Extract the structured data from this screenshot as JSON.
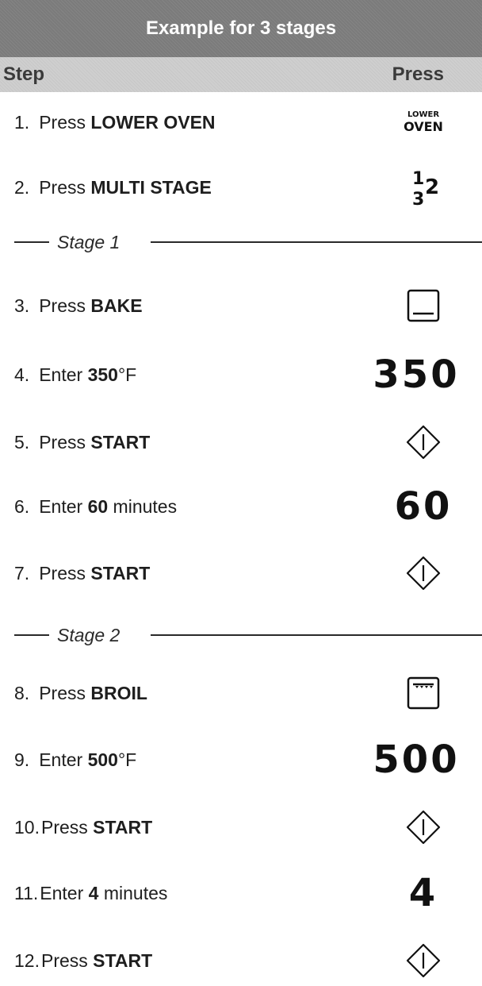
{
  "table": {
    "title": "Example for 3 stages",
    "header_step": "Step",
    "header_press": "Press"
  },
  "rows": [
    {
      "num": "1.",
      "pre": "Press ",
      "bold": "LOWER OVEN",
      "post": "",
      "icon": "lower-oven-icon",
      "icon_top": "LOWER",
      "icon_bottom": "OVEN"
    },
    {
      "num": "2.",
      "pre": "Press ",
      "bold": "MULTI STAGE",
      "post": "",
      "icon": "multi-stage-icon",
      "icon_a": "1",
      "icon_b": "2",
      "icon_c": "3"
    },
    {
      "num": "3.",
      "pre": "Press ",
      "bold": "BAKE",
      "post": "",
      "icon": "bake-icon"
    },
    {
      "num": "4.",
      "pre": "Enter ",
      "bold": "350",
      "post": "°F",
      "icon": "display-number",
      "display": "350"
    },
    {
      "num": "5.",
      "pre": "Press ",
      "bold": "START",
      "post": "",
      "icon": "start-icon"
    },
    {
      "num": "6.",
      "pre": "Enter ",
      "bold": "60",
      "post": " minutes",
      "icon": "display-number",
      "display": "60"
    },
    {
      "num": "7.",
      "pre": "Press ",
      "bold": "START",
      "post": "",
      "icon": "start-icon"
    },
    {
      "num": "8.",
      "pre": "Press ",
      "bold": "BROIL",
      "post": "",
      "icon": "broil-icon"
    },
    {
      "num": "9.",
      "pre": "Enter ",
      "bold": "500",
      "post": "°F",
      "icon": "display-number",
      "display": "500"
    },
    {
      "num": "10.",
      "pre": "Press ",
      "bold": "START",
      "post": "",
      "icon": "start-icon"
    },
    {
      "num": "11.",
      "pre": "Enter ",
      "bold": "4",
      "post": " minutes",
      "icon": "display-number",
      "display": "4"
    },
    {
      "num": "12.",
      "pre": "Press ",
      "bold": "START",
      "post": "",
      "icon": "start-icon"
    }
  ],
  "stages": [
    {
      "label": "Stage 1"
    },
    {
      "label": "Stage 2"
    }
  ]
}
